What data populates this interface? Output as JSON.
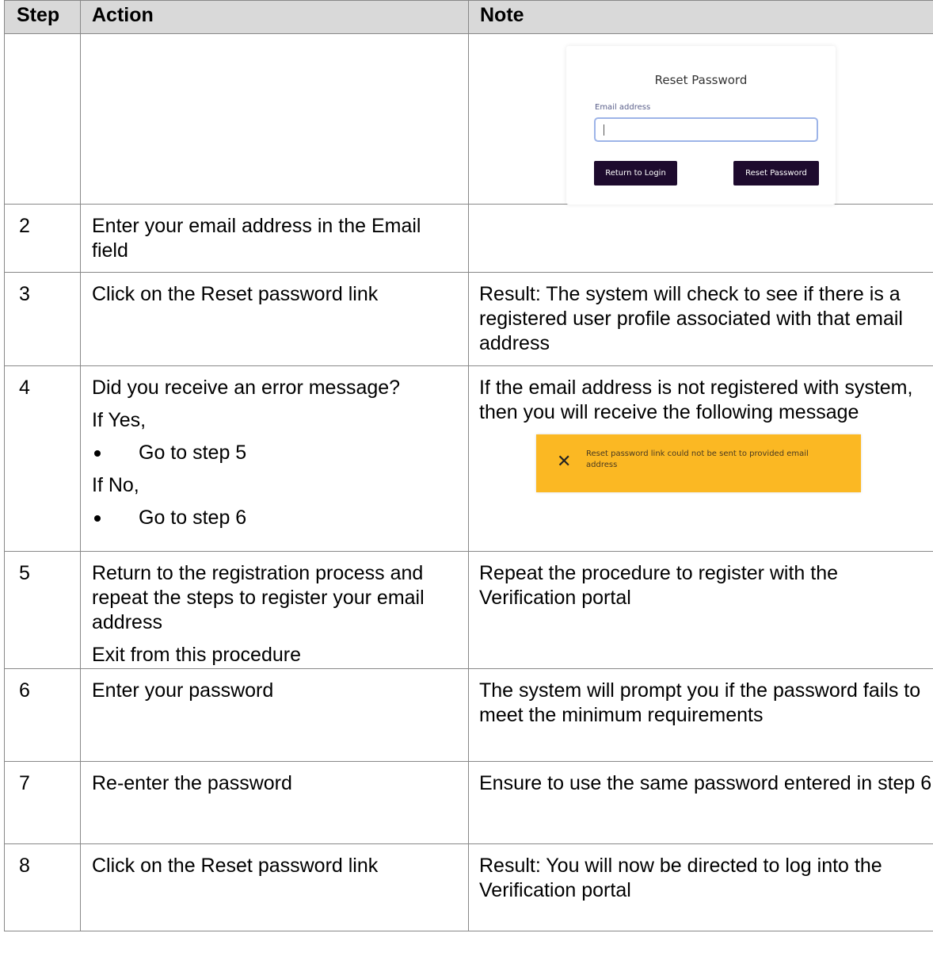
{
  "table": {
    "headers": {
      "step": "Step",
      "action": "Action",
      "note": "Note"
    },
    "reset_card": {
      "title": "Reset Password",
      "email_label": "Email address",
      "email_value": "",
      "return_button": "Return to Login",
      "reset_button": "Reset Password"
    },
    "error_banner": {
      "icon": "close-icon",
      "message": "Reset password link could not be sent to provided email address"
    },
    "rows": [
      {
        "step": "2",
        "action": "Enter your email address in the Email field",
        "note": ""
      },
      {
        "step": "3",
        "action": "Click on the Reset password link",
        "note": "Result: The system will check to see if there is a registered user profile associated with that email address"
      },
      {
        "step": "4",
        "action_question": "Did you receive an error message?",
        "if_yes": "If Yes,",
        "yes_bullet": "Go to step 5",
        "if_no": "If No,",
        "no_bullet": "Go to step 6",
        "note": "If the email address is not registered with system, then you will receive the following message"
      },
      {
        "step": "5",
        "action": "Return to the registration process and repeat the steps to register your email address",
        "action_exit": "Exit from this procedure",
        "note": "Repeat the procedure to register with the Verification portal"
      },
      {
        "step": "6",
        "action": "Enter your password",
        "note": "The system will prompt you if the password fails to meet the minimum requirements"
      },
      {
        "step": "7",
        "action": "Re-enter the password",
        "note": "Ensure to use the same password entered in step 6"
      },
      {
        "step": "8",
        "action": "Click on the Reset password link",
        "note": "Result: You will now be directed to log into the Verification portal"
      }
    ]
  }
}
